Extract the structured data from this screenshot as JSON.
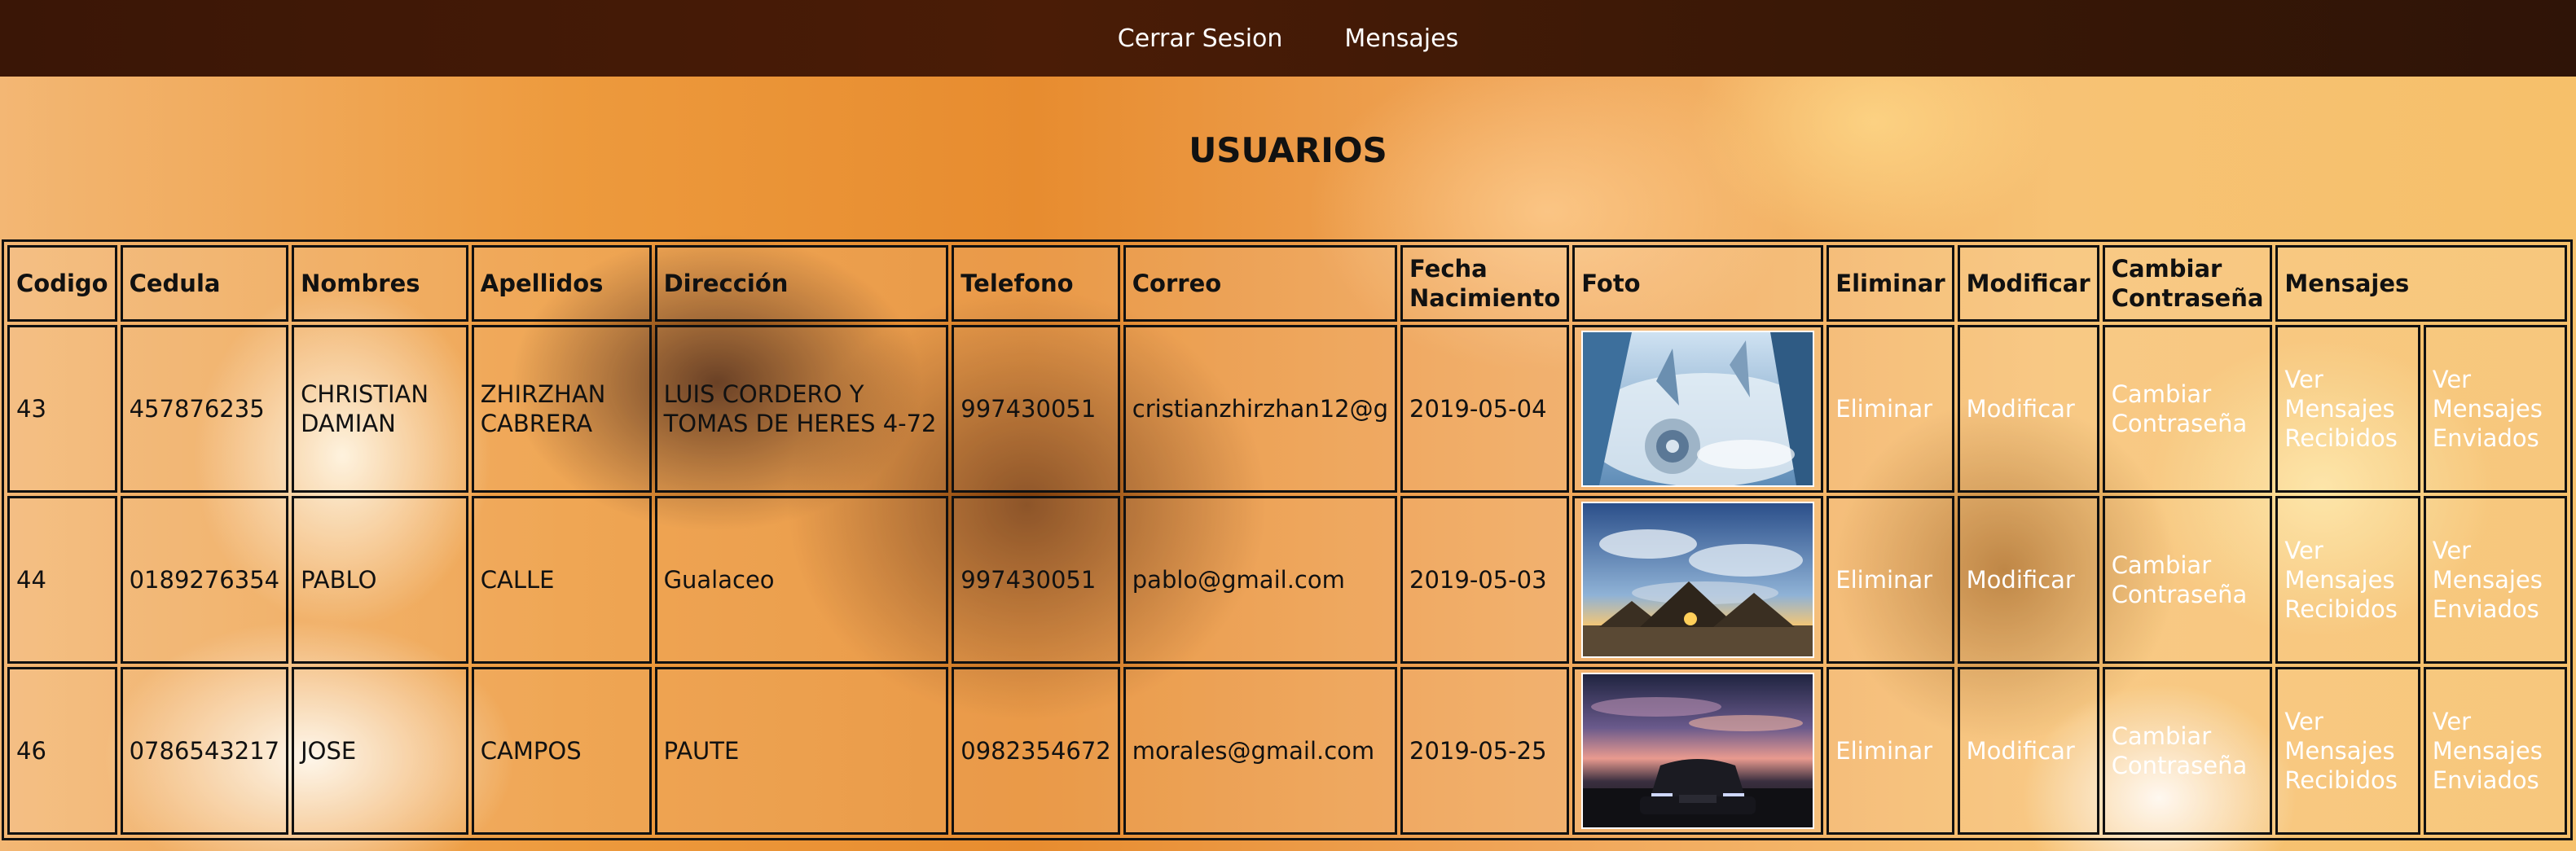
{
  "nav": {
    "logout": "Cerrar Sesion",
    "messages": "Mensajes"
  },
  "page_title": "USUARIOS",
  "table": {
    "headers": {
      "codigo": "Codigo",
      "cedula": "Cedula",
      "nombres": "Nombres",
      "apellidos": "Apellidos",
      "direccion": "Dirección",
      "telefono": "Telefono",
      "correo": "Correo",
      "fecha_line1": "Fecha",
      "fecha_line2": "Nacimiento",
      "foto": "Foto",
      "eliminar": "Eliminar",
      "modificar": "Modificar",
      "cambiar_line1": "Cambiar",
      "cambiar_line2": "Contraseña",
      "mensajes": "Mensajes"
    },
    "rows": [
      {
        "codigo": "43",
        "cedula": "457876235",
        "nombres": "CHRISTIAN DAMIAN",
        "apellidos": "ZHIRZHAN CABRERA",
        "direccion": "LUIS CORDERO Y TOMAS DE HERES 4-72",
        "telefono": "997430051",
        "correo": "cristianzhirzhan12@g",
        "fecha": "2019-05-04",
        "foto": "city-skyscraper-photo",
        "eliminar": "Eliminar",
        "modificar": "Modificar",
        "cambiar": "Cambiar Contraseña",
        "ver_recibidos": "Ver Mensajes Recibidos",
        "ver_enviados": "Ver Mensajes Enviados"
      },
      {
        "codigo": "44",
        "cedula": "0189276354",
        "nombres": "PABLO",
        "apellidos": "CALLE",
        "direccion": "Gualaceo",
        "telefono": "997430051",
        "correo": "pablo@gmail.com",
        "fecha": "2019-05-03",
        "foto": "pyramids-photo",
        "eliminar": "Eliminar",
        "modificar": "Modificar",
        "cambiar": "Cambiar Contraseña",
        "ver_recibidos": "Ver Mensajes Recibidos",
        "ver_enviados": "Ver Mensajes Enviados"
      },
      {
        "codigo": "46",
        "cedula": "0786543217",
        "nombres": "JOSE",
        "apellidos": "CAMPOS",
        "direccion": "PAUTE",
        "telefono": "0982354672",
        "correo": "morales@gmail.com",
        "fecha": "2019-05-25",
        "foto": "car-sunset-photo",
        "eliminar": "Eliminar",
        "modificar": "Modificar",
        "cambiar": "Cambiar Contraseña",
        "ver_recibidos": "Ver Mensajes Recibidos",
        "ver_enviados": "Ver Mensajes Enviados"
      }
    ]
  }
}
